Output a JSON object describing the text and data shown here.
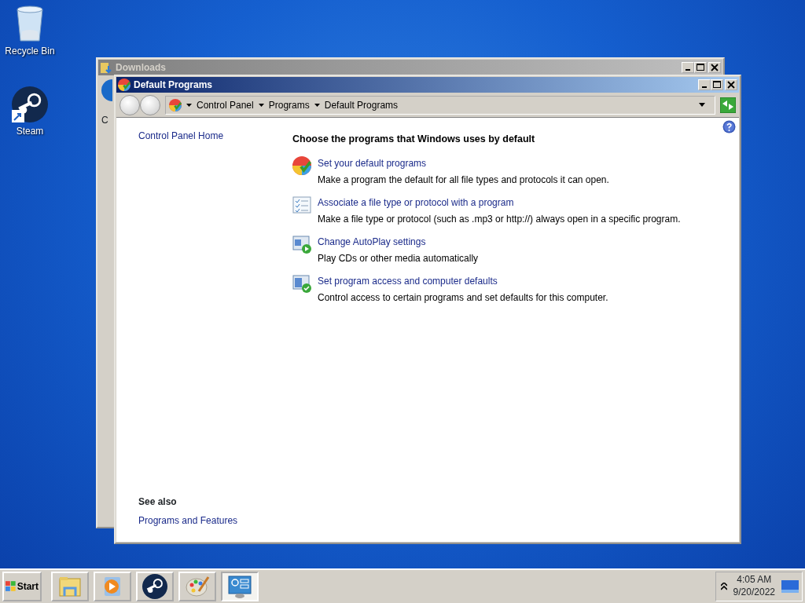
{
  "desktop_icons": [
    {
      "kind": "recycle",
      "label": "Recycle Bin"
    },
    {
      "kind": "steam",
      "label": "Steam"
    }
  ],
  "background_window": {
    "title": "Downloads",
    "partial_text": "C"
  },
  "window": {
    "title": "Default Programs",
    "breadcrumb": [
      "Control Panel",
      "Programs",
      "Default Programs"
    ]
  },
  "sidebar": {
    "links": [
      "Control Panel Home"
    ],
    "see_also": {
      "heading": "See also",
      "links": [
        "Programs and Features"
      ]
    }
  },
  "main": {
    "heading": "Choose the programs that Windows uses by default",
    "tasks": [
      {
        "kind": "defaults",
        "title": "Set your default programs",
        "description": "Make a program the default for all file types and protocols it can open."
      },
      {
        "kind": "associate",
        "title": "Associate a file type or protocol with a program",
        "description": "Make a file type or protocol (such as .mp3 or http://) always open in a specific program."
      },
      {
        "kind": "autoplay",
        "title": "Change AutoPlay settings",
        "description": "Play CDs or other media automatically"
      },
      {
        "kind": "access",
        "title": "Set program access and computer defaults",
        "description": "Control access to certain programs and set defaults for this computer."
      }
    ]
  },
  "taskbar": {
    "start": "Start",
    "buttons": [
      {
        "kind": "explorer",
        "selected": false
      },
      {
        "kind": "media",
        "selected": false
      },
      {
        "kind": "steam",
        "selected": false
      },
      {
        "kind": "paint",
        "selected": false
      },
      {
        "kind": "controlpanel",
        "selected": true
      }
    ],
    "clock": {
      "time": "4:05 AM",
      "date": "9/20/2022"
    }
  }
}
